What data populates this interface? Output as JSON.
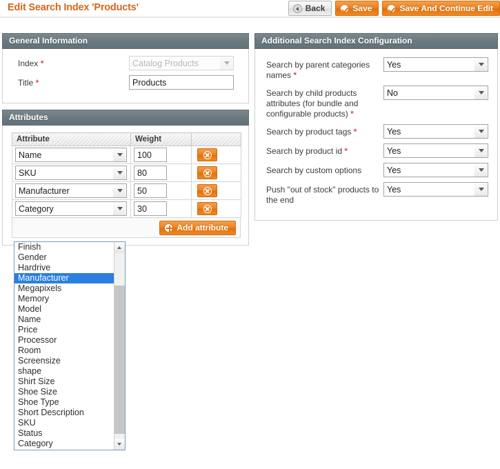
{
  "header": {
    "title": "Edit Search Index 'Products'",
    "buttons": [
      {
        "label": "Back",
        "icon": "back-arrow-icon",
        "style": "grey"
      },
      {
        "label": "Save",
        "icon": "check-circle-icon",
        "style": "orange"
      },
      {
        "label": "Save And Continue Edit",
        "icon": "check-circle-icon",
        "style": "orange"
      }
    ]
  },
  "general": {
    "panel_title": "General Information",
    "index": {
      "label": "Index",
      "required": "*",
      "value": "Catalog Products",
      "disabled": true
    },
    "title": {
      "label": "Title",
      "required": "*",
      "value": "Products"
    }
  },
  "attributes": {
    "panel_title": "Attributes",
    "columns": [
      "Attribute",
      "Weight",
      ""
    ],
    "rows": [
      {
        "attribute": "Name",
        "weight": "100",
        "delete_label": "Delete"
      },
      {
        "attribute": "SKU",
        "weight": "80",
        "delete_label": "Delete"
      },
      {
        "attribute": "Manufacturer",
        "weight": "50",
        "delete_label": "Delete"
      },
      {
        "attribute": "Category",
        "weight": "30",
        "delete_label": "Delete"
      }
    ],
    "add_button": {
      "label": "Add attribute",
      "icon": "plus-circle-icon"
    }
  },
  "open_dropdown": {
    "selected": "Manufacturer",
    "options": [
      "Finish",
      "Gender",
      "Hardrive",
      "Manufacturer",
      "Megapixels",
      "Memory",
      "Model",
      "Name",
      "Price",
      "Processor",
      "Room",
      "Screensize",
      "shape",
      "Shirt Size",
      "Shoe Size",
      "Shoe Type",
      "Short Description",
      "SKU",
      "Status",
      "Category"
    ]
  },
  "additional": {
    "panel_title": "Additional Search Index Configuration",
    "fields": [
      {
        "label": "Search by parent categories names",
        "required": "*",
        "value": "Yes"
      },
      {
        "label": "Search by child products attributes (for bundle and configurable products)",
        "required": "*",
        "value": "No"
      },
      {
        "label": "Search by product tags",
        "required": "*",
        "value": "Yes"
      },
      {
        "label": "Search by product id",
        "required": "*",
        "value": "Yes"
      },
      {
        "label": "Search by custom options",
        "required": "",
        "value": "Yes"
      },
      {
        "label": "Push \"out of stock\" products to the end",
        "required": "",
        "value": "Yes"
      }
    ],
    "options": [
      "Yes",
      "No"
    ]
  },
  "colors": {
    "accent_orange": "#e2700d",
    "panel_header": "#6a787e",
    "required_red": "#d9534f",
    "selection_blue": "#2a7fe0"
  }
}
